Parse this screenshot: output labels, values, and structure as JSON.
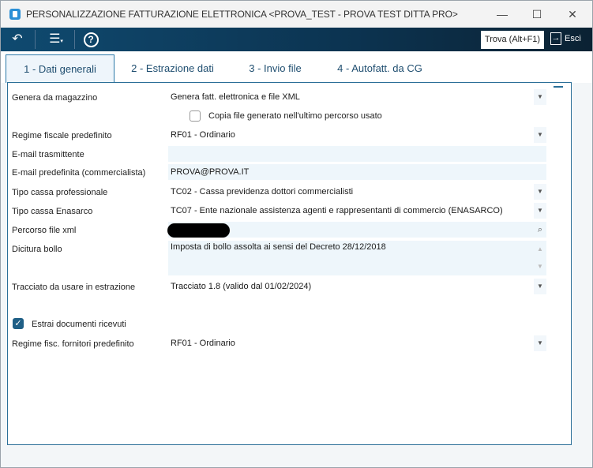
{
  "window": {
    "title": "PERSONALIZZAZIONE FATTURAZIONE ELETTRONICA <PROVA_TEST - PROVA TEST DITTA PRO>"
  },
  "toolbar": {
    "find_label": "Trova (Alt+F1)",
    "exit_label": "Esci"
  },
  "tabs": [
    {
      "label": "1 - Dati generali"
    },
    {
      "label": "2 - Estrazione dati"
    },
    {
      "label": "3 - Invio file"
    },
    {
      "label": "4 - Autofatt. da CG"
    }
  ],
  "form": {
    "genera_label": "Genera da magazzino",
    "genera_value": "Genera fatt. elettronica e file XML",
    "copia_label": "Copia file generato nell'ultimo percorso usato",
    "regime_label": "Regime fiscale predefinito",
    "regime_value": "RF01 - Ordinario",
    "email_tx_label": "E-mail trasmittente",
    "email_tx_value": "",
    "email_comm_label": "E-mail predefinita (commercialista)",
    "email_comm_value": "PROVA@PROVA.IT",
    "cassa_prof_label": "Tipo cassa professionale",
    "cassa_prof_value": "TC02 - Cassa previdenza dottori commercialisti",
    "cassa_ena_label": "Tipo cassa Enasarco",
    "cassa_ena_value": "TC07 - Ente nazionale assistenza agenti e rappresentanti di commercio (ENASARCO)",
    "percorso_label": "Percorso file xml",
    "bollo_label": "Dicitura bollo",
    "bollo_value": "Imposta di bollo assolta ai sensi del Decreto 28/12/2018",
    "tracciato_label": "Tracciato da usare in estrazione",
    "tracciato_value": "Tracciato 1.8 (valido dal 01/02/2024)",
    "estrai_label": "Estrai documenti ricevuti",
    "regime_forn_label": "Regime fisc. fornitori predefinito",
    "regime_forn_value": "RF01 - Ordinario"
  }
}
